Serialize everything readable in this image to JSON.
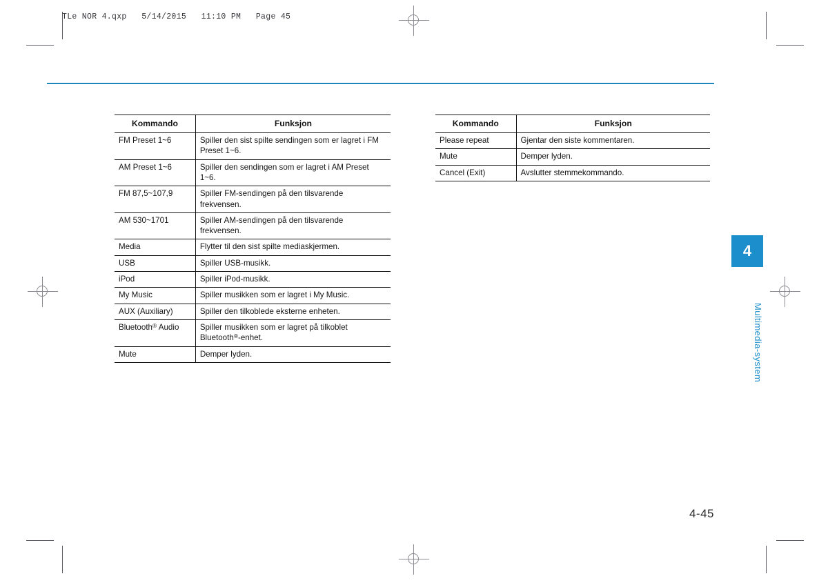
{
  "page": {
    "file_header": "TLe NOR 4.qxp   5/14/2015   11:10 PM   Page 45",
    "folio": "4-45",
    "rule_color": "#1b87ba"
  },
  "chapter": {
    "number": "4",
    "label": "Multimedia-system",
    "accent_color": "#1c8ecb"
  },
  "tables": [
    {
      "id": "left",
      "headers": {
        "command": "Kommando",
        "function": "Funksjon"
      },
      "rows": [
        {
          "command": "FM Preset 1~6",
          "function": "Spiller den sist spilte sendingen som er lagret i FM Preset 1~6."
        },
        {
          "command": "AM Preset 1~6",
          "function": "Spiller den sendingen som er lagret i AM Preset 1~6."
        },
        {
          "command": "FM 87,5~107,9",
          "function": "Spiller FM-sendingen på den tilsvarende frekvensen."
        },
        {
          "command": "AM 530~1701",
          "function": "Spiller AM-sendingen på den tilsvarende frekvensen."
        },
        {
          "command": "Media",
          "function": "Flytter til den sist spilte mediaskjermen."
        },
        {
          "command": "USB",
          "function": "Spiller USB-musikk."
        },
        {
          "command": "iPod",
          "function": "Spiller iPod-musikk."
        },
        {
          "command": "My Music",
          "function": "Spiller musikken som er lagret i My Music."
        },
        {
          "command": "AUX (Auxiliary)",
          "function": "Spiller den tilkoblede eksterne enheten."
        },
        {
          "command": "Bluetooth® Audio",
          "function": "Spiller musikken som er lagret på tilkoblet Bluetooth®-enhet."
        },
        {
          "command": "Mute",
          "function": "Demper lyden."
        }
      ]
    },
    {
      "id": "right",
      "headers": {
        "command": "Kommando",
        "function": "Funksjon"
      },
      "rows": [
        {
          "command": "Please repeat",
          "function": "Gjentar den siste kommentaren."
        },
        {
          "command": "Mute",
          "function": "Demper lyden."
        },
        {
          "command": "Cancel (Exit)",
          "function": "Avslutter stemmekommando."
        }
      ]
    }
  ]
}
